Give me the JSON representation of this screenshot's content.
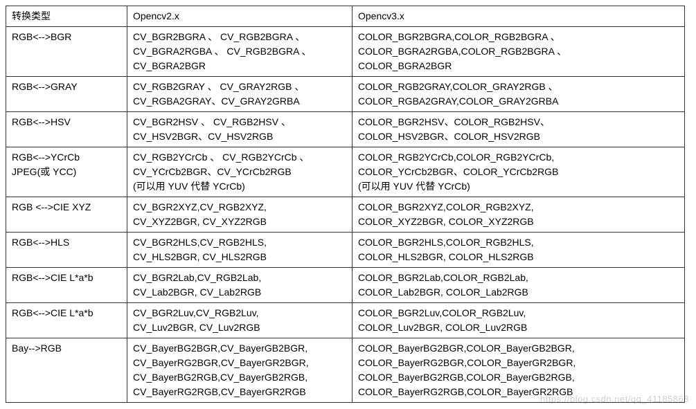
{
  "table": {
    "headers": [
      "转换类型",
      "Opencv2.x",
      "Opencv3.x"
    ],
    "rows": [
      {
        "c1": [
          "RGB<-->BGR"
        ],
        "c2": [
          "CV_BGR2BGRA 、 CV_RGB2BGRA 、",
          "CV_BGRA2RGBA 、 CV_RGB2BGRA 、",
          "CV_BGRA2BGR"
        ],
        "c3": [
          "COLOR_BGR2BGRA,COLOR_RGB2BGRA                                     、",
          "COLOR_BGRA2RGBA,COLOR_RGB2BGRA                                    、",
          "COLOR_BGRA2BGR"
        ]
      },
      {
        "c1": [
          "RGB<-->GRAY"
        ],
        "c2": [
          "CV_RGB2GRAY 、 CV_GRAY2RGB 、",
          "CV_RGBA2GRAY、CV_GRAY2GRBA"
        ],
        "c3": [
          "COLOR_RGB2GRAY,COLOR_GRAY2RGB                                       、",
          "COLOR_RGBA2GRAY,COLOR_GRAY2GRBA"
        ]
      },
      {
        "c1": [
          "RGB<-->HSV"
        ],
        "c2": [
          "CV_BGR2HSV  、  CV_RGB2HSV  、",
          "CV_HSV2BGR、CV_HSV2RGB"
        ],
        "c3": [
          "COLOR_BGR2HSV、COLOR_RGB2HSV、",
          "COLOR_HSV2BGR、COLOR_HSV2RGB"
        ]
      },
      {
        "c1": [
          "RGB<-->YCrCb",
          "JPEG(或 YCC)"
        ],
        "c2": [
          "CV_RGB2YCrCb 、 CV_RGB2YCrCb 、",
          "CV_YCrCb2BGR、CV_YCrCb2RGB",
          "(可以用 YUV 代替 YCrCb)"
        ],
        "c3": [
          "COLOR_RGB2YCrCb,COLOR_RGB2YCrCb,",
          "COLOR_YCrCb2BGR、COLOR_YCrCb2RGB",
          "(可以用 YUV 代替 YCrCb)"
        ]
      },
      {
        "c1": [
          "RGB <-->CIE XYZ"
        ],
        "c2": [
          "CV_BGR2XYZ,CV_RGB2XYZ,",
          "CV_XYZ2BGR, CV_XYZ2RGB"
        ],
        "c3": [
          "COLOR_BGR2XYZ,COLOR_RGB2XYZ,",
          "COLOR_XYZ2BGR, COLOR_XYZ2RGB"
        ]
      },
      {
        "c1": [
          "RGB<-->HLS"
        ],
        "c2": [
          "CV_BGR2HLS,CV_RGB2HLS,",
          "CV_HLS2BGR, CV_HLS2RGB"
        ],
        "c3": [
          "COLOR_BGR2HLS,COLOR_RGB2HLS,",
          "COLOR_HLS2BGR, COLOR_HLS2RGB"
        ]
      },
      {
        "c1": [
          "RGB<-->CIE L*a*b"
        ],
        "c2": [
          "CV_BGR2Lab,CV_RGB2Lab,",
          "CV_Lab2BGR, CV_Lab2RGB"
        ],
        "c3": [
          "COLOR_BGR2Lab,COLOR_RGB2Lab,",
          "COLOR_Lab2BGR, COLOR_Lab2RGB"
        ]
      },
      {
        "c1": [
          "RGB<-->CIE L*a*b"
        ],
        "c2": [
          "CV_BGR2Luv,CV_RGB2Luv,",
          "CV_Luv2BGR, CV_Luv2RGB"
        ],
        "c3": [
          "COLOR_BGR2Luv,COLOR_RGB2Luv,",
          "COLOR_Luv2BGR, COLOR_Luv2RGB"
        ]
      },
      {
        "c1": [
          "Bay-->RGB"
        ],
        "c2": [
          "CV_BayerBG2BGR,CV_BayerGB2BGR,",
          "CV_BayerRG2BGR,CV_BayerGR2BGR,",
          "CV_BayerBG2RGB,CV_BayerGB2RGB,",
          "CV_BayerRG2RGB,CV_BayerGR2RGB"
        ],
        "c3": [
          "COLOR_BayerBG2BGR,COLOR_BayerGB2BGR,",
          "COLOR_BayerRG2BGR,COLOR_BayerGR2BGR,",
          "COLOR_BayerBG2RGB,COLOR_BayerGB2RGB,",
          "COLOR_BayerRG2RGB,COLOR_BayerGR2RGB"
        ]
      }
    ]
  },
  "watermark": "https://blog.csdn.net/qq_41185868"
}
